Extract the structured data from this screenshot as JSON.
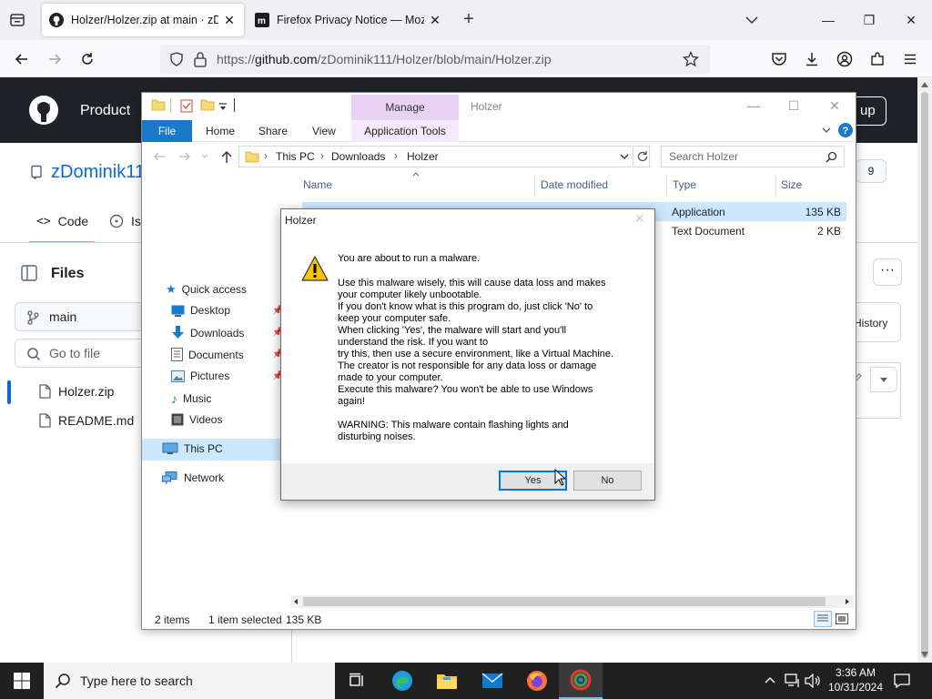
{
  "browser": {
    "tabs": [
      {
        "title": "Holzer/Holzer.zip at main · zDominik111/Holzer"
      },
      {
        "title": "Firefox Privacy Notice — Mozilla"
      }
    ],
    "url": {
      "prefix": "https://",
      "host": "github.com",
      "path": "/zDominik111/Holzer/blob/main/Holzer.zip"
    }
  },
  "github": {
    "nav_product": "Product",
    "signup": "up",
    "repo_owner": "zDominik11",
    "tabs": {
      "code": "Code",
      "issues": "Is"
    },
    "star_count": "9",
    "files_title": "Files",
    "branch": "main",
    "goto_placeholder": "Go to file",
    "files": [
      "Holzer.zip",
      "README.md"
    ],
    "history": "History",
    "more": "···"
  },
  "explorer": {
    "manage": "Manage",
    "window_title": "Holzer",
    "ribbon": {
      "file": "File",
      "home": "Home",
      "share": "Share",
      "view": "View",
      "app_tools": "Application Tools"
    },
    "breadcrumb": [
      "This PC",
      "Downloads",
      "Holzer"
    ],
    "search_placeholder": "Search Holzer",
    "nav": {
      "quick_access": "Quick access",
      "desktop": "Desktop",
      "downloads": "Downloads",
      "documents": "Documents",
      "pictures": "Pictures",
      "music": "Music",
      "videos": "Videos",
      "this_pc": "This PC",
      "network": "Network"
    },
    "columns": {
      "name": "Name",
      "date": "Date modified",
      "type": "Type",
      "size": "Size"
    },
    "rows": [
      {
        "type": "Application",
        "size": "135 KB"
      },
      {
        "type": "Text Document",
        "size": "2 KB"
      }
    ],
    "status": {
      "count": "2 items",
      "selected": "1 item selected",
      "size": "135 KB"
    }
  },
  "dialog": {
    "title": "Holzer",
    "line1": "You are about to run a malware.",
    "body": "Use this malware wisely, this will cause data loss and makes\nyour computer likely unbootable.\nIf you don't know what is this program do, just click 'No' to\nkeep your computer safe.\nWhen clicking 'Yes', the malware will start and you'll\nunderstand the risk. If you want to\ntry this, then use a secure environment, like a Virtual Machine.\nThe creator is not responsible for any data loss or damage\nmade to your computer.\nExecute this malware? You won't be able to use Windows\nagain!",
    "warning": "WARNING: This malware contain flashing lights and\ndisturbing noises.",
    "yes": "Yes",
    "no": "No"
  },
  "taskbar": {
    "search_placeholder": "Type here to search",
    "time": "3:36 AM",
    "date": "10/31/2024"
  },
  "colors": {
    "accent": "#0078d7",
    "github_header": "#1f2328",
    "manage_tab": "#e8d3f5"
  }
}
